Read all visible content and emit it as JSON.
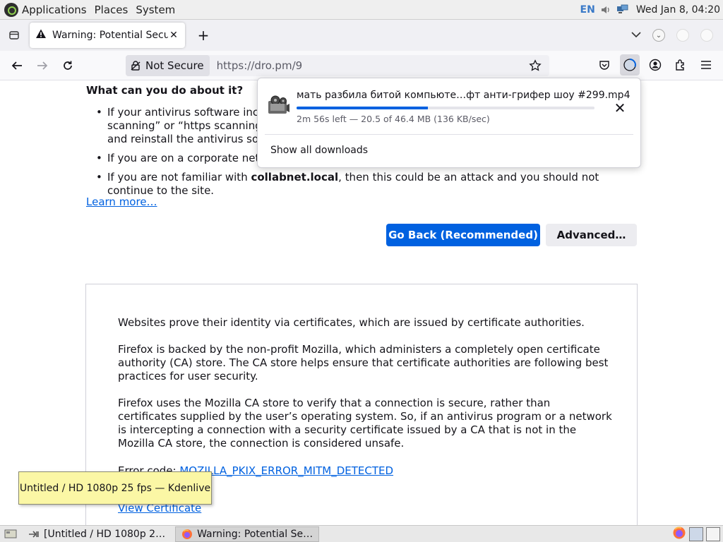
{
  "top_panel": {
    "menus": [
      "Applications",
      "Places",
      "System"
    ],
    "lang": "EN",
    "clock": "Wed Jan  8, 04:20"
  },
  "tab_bar": {
    "tab_title": "Warning: Potential Security Risk Ahead",
    "new_tab": "+"
  },
  "nav_bar": {
    "not_secure": "Not Secure",
    "url": "https://dro.pm/9"
  },
  "page": {
    "what_heading": "What can you do about it?",
    "bullet_1": "If your antivirus software includes a feature that scans encrypted connections (often called “web scanning” or “https scanning”), you can disable that feature. If that doesn’t work, you can remove and reinstall the antivirus software.",
    "bullet_2_pre": "If you are on a corporate network, you can contact your IT department.",
    "bullet_3_pre": "If you are not familiar with ",
    "bullet_3_bold": "collabnet.local",
    "bullet_3_post": ", then this could be an attack and you should not continue to the site.",
    "learn_more": "Learn more…",
    "go_back": "Go Back (Recommended)",
    "advanced": "Advanced…",
    "adv_p1": "Websites prove their identity via certificates, which are issued by certificate authorities.",
    "adv_p2": "Firefox is backed by the non-profit Mozilla, which administers a completely open certificate authority (CA) store. The CA store helps ensure that certificate authorities are following best practices for user security.",
    "adv_p3": "Firefox uses the Mozilla CA store to verify that a connection is secure, rather than certificates supplied by the user’s operating system. So, if an antivirus program or a network is intercepting a connection with a security certificate issued by a CA that is not in the Mozilla CA store, the connection is considered unsafe.",
    "error_code_label": "Error code: ",
    "error_code": "MOZILLA_PKIX_ERROR_MITM_DETECTED",
    "view_certificate": "View Certificate"
  },
  "downloads": {
    "filename": "мать разбила битой компьюте…фт анти-грифер шоу #299.mp4",
    "status": "2m 56s left — 20.5 of 46.4 MB (136 KB/sec)",
    "progress_fraction": 0.44,
    "show_all": "Show all downloads"
  },
  "tooltip": {
    "text": "Untitled / HD 1080p 25 fps — Kdenlive"
  },
  "taskbar": {
    "task_1": "[Untitled / HD 1080p 2…",
    "task_2": "Warning: Potential Se…"
  },
  "colors": {
    "accent": "#0061e0",
    "tooltip_bg": "#fbf7a5"
  }
}
